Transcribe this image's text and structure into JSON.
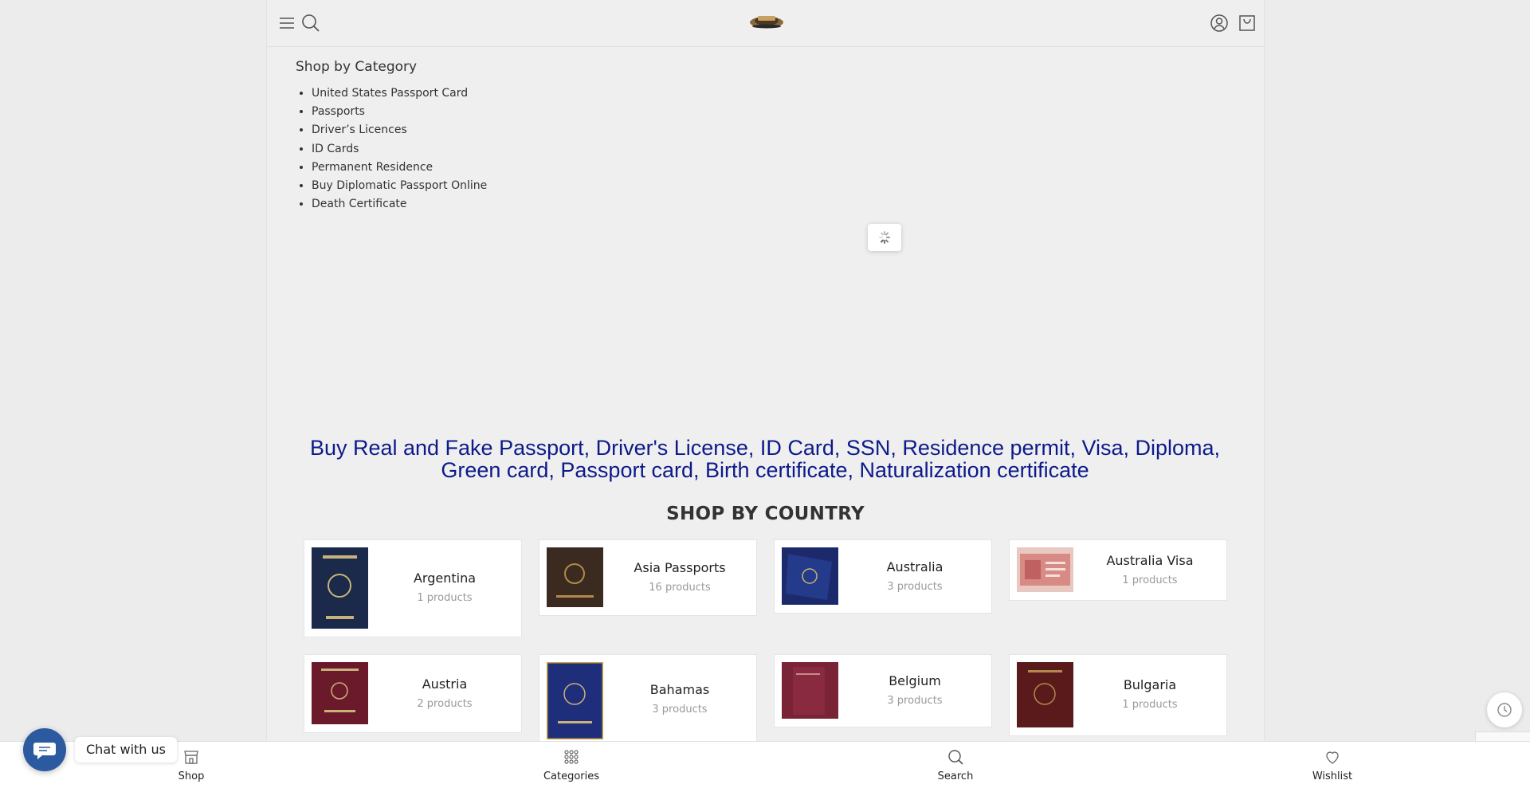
{
  "header": {
    "menu_icon": "hamburger-icon",
    "search_icon": "search-icon",
    "account_icon": "user-icon",
    "cart_icon": "bag-icon"
  },
  "sidebar_categories": {
    "title": "Shop by Category",
    "items": [
      "United States Passport Card",
      "Passports",
      "Driver’s Licences",
      "ID Cards",
      "Permanent Residence",
      "Buy Diplomatic Passport Online",
      "Death Certificate"
    ]
  },
  "headline": "Buy Real and Fake Passport, Driver's License, ID Card, SSN, Residence permit, Visa, Diploma, Green card, Passport card, Birth certificate, Naturalization certificate",
  "shop_by_country": {
    "title": "SHOP BY COUNTRY",
    "cards": [
      {
        "name": "Argentina",
        "count": "1 products",
        "color": "#1b2a4a"
      },
      {
        "name": "Asia Passports",
        "count": "16 products",
        "color": "#3a2a20"
      },
      {
        "name": "Australia",
        "count": "3 products",
        "color": "#1c2a6b"
      },
      {
        "name": "Australia Visa",
        "count": "1 products",
        "color": "#c87f7a"
      },
      {
        "name": "Austria",
        "count": "2 products",
        "color": "#6a1a2a"
      },
      {
        "name": "Bahamas",
        "count": "3 products",
        "color": "#1e2e7a"
      },
      {
        "name": "Belgium",
        "count": "3 products",
        "color": "#7a2236"
      },
      {
        "name": "Bulgaria",
        "count": "1 products",
        "color": "#5a1a1c"
      }
    ]
  },
  "bottom_nav": {
    "shop": "Shop",
    "categories": "Categories",
    "search": "Search",
    "wishlist": "Wishlist"
  },
  "chat": {
    "label": "Chat with us"
  },
  "colors": {
    "headline": "#0c1a8a",
    "chat_button": "#2c5aa0"
  }
}
